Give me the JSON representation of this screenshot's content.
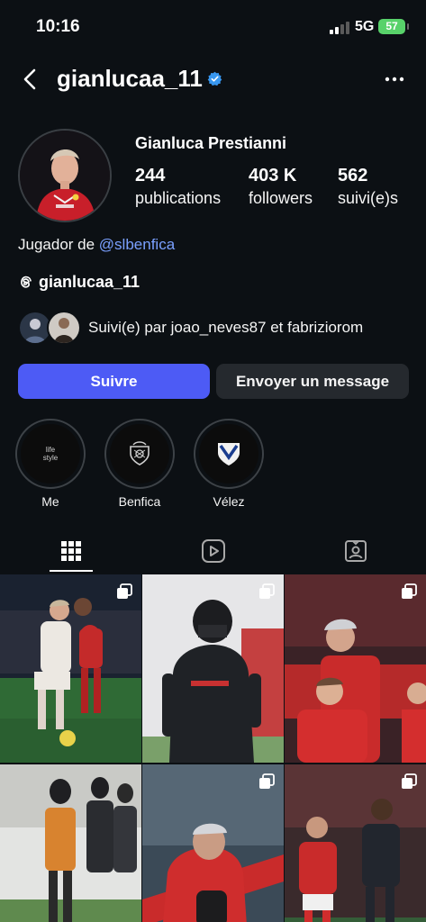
{
  "status_bar": {
    "time": "10:16",
    "network": "5G",
    "battery": "57"
  },
  "header": {
    "username": "gianlucaa_11",
    "verified": true
  },
  "profile": {
    "display_name": "Gianluca Prestianni",
    "stats": [
      {
        "value": "244",
        "label": "publications"
      },
      {
        "value": "403 K",
        "label": "followers"
      },
      {
        "value": "562",
        "label": "suivi(e)s"
      }
    ],
    "bio_prefix": "Jugador de ",
    "bio_mention": "@slbenfica",
    "threads_handle": "gianlucaa_11",
    "followed_by": "Suivi(e) par joao_neves87 et fabriziorom"
  },
  "actions": {
    "follow": "Suivre",
    "message": "Envoyer un message"
  },
  "highlights": [
    {
      "label": "Me",
      "cover_text": "life style"
    },
    {
      "label": "Benfica"
    },
    {
      "label": "Vélez"
    }
  ],
  "tabs": [
    {
      "icon": "grid-icon",
      "active": true
    },
    {
      "icon": "reels-icon",
      "active": false
    },
    {
      "icon": "tagged-icon",
      "active": false
    }
  ],
  "posts": [
    {
      "type": "carousel"
    },
    {
      "type": "carousel"
    },
    {
      "type": "carousel"
    },
    {
      "type": "carousel"
    },
    {
      "type": "carousel"
    },
    {
      "type": "carousel"
    }
  ],
  "colors": {
    "background": "#0c1014",
    "follow_button": "#4d5bf5",
    "secondary_button": "#25292e",
    "mention": "#7aa0ff",
    "verified": "#3897f0",
    "benfica_red": "#d21f2b"
  }
}
